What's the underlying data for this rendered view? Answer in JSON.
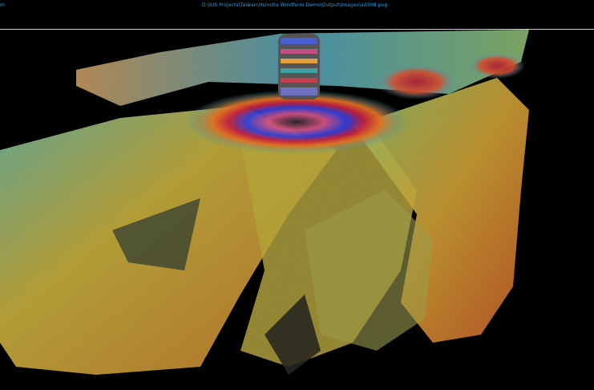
{
  "titlebar": {
    "app_fragment": "m",
    "path": "D:\\IUS Projects\\Taiwan\\Hsinchu Windfarm Demo\\Output\\Images\\ad308.png"
  },
  "viewport": {
    "description_icon": "seabed-point-cloud-render",
    "nav_widget_icon": "compass-navigation-icon"
  },
  "colors": {
    "title_text": "#2aa0e6",
    "background": "#000000",
    "divider": "#cfcfcf"
  }
}
